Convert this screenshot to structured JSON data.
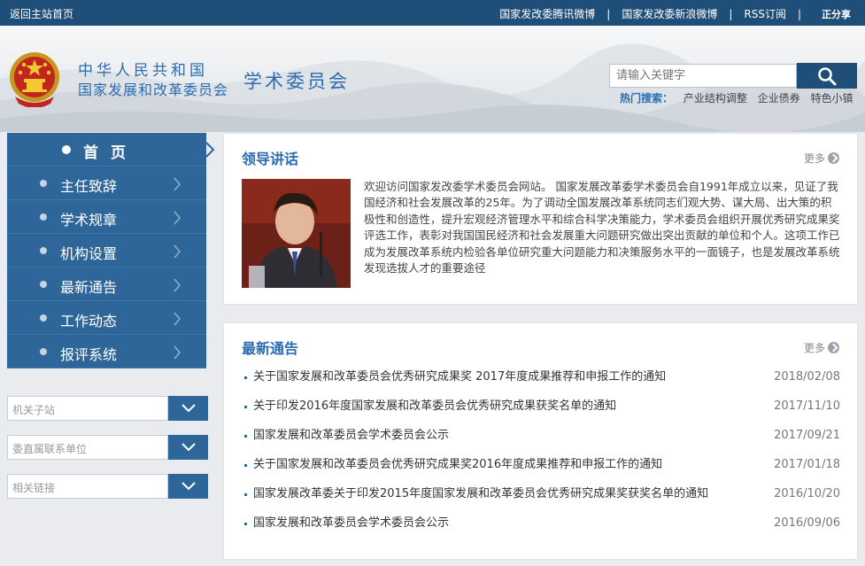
{
  "topbar": {
    "home_link": "返回主站首页",
    "links": [
      "国家发改委腾讯微博",
      "国家发改委新浪微博",
      "RSS订阅"
    ],
    "pc_version": "正分享"
  },
  "header": {
    "org_line1": "中华人民共和国",
    "org_line2": "国家发展和改革委员会",
    "subtitle": "学术委员会",
    "search_placeholder": "请输入关键字",
    "hot_label": "热门搜索：",
    "hot_items": [
      "产业结构调整",
      "企业债券",
      "特色小镇"
    ]
  },
  "nav": {
    "items": [
      {
        "label": "首页"
      },
      {
        "label": "主任致辞"
      },
      {
        "label": "学术规章"
      },
      {
        "label": "机构设置"
      },
      {
        "label": "最新通告"
      },
      {
        "label": "工作动态"
      },
      {
        "label": "报评系统"
      }
    ]
  },
  "dropdowns": [
    {
      "label": "机关子站"
    },
    {
      "label": "委直属联系单位"
    },
    {
      "label": "相关链接"
    }
  ],
  "speech": {
    "title": "领导讲话",
    "more": "更多",
    "text": "欢迎访问国家发改委学术委员会网站。 国家发展改革委学术委员会自1991年成立以来，见证了我国经济和社会发展改革的25年。为了调动全国发展改革系统同志们观大势、谋大局、出大策的积极性和创造性，提升宏观经济管理水平和综合科学决策能力，学术委员会组织开展优秀研究成果奖评选工作，表彰对我国国民经济和社会发展重大问题研究做出突出贡献的单位和个人。这项工作已成为发展改革系统内检验各单位研究重大问题能力和决策服务水平的一面镜子，也是发展改革系统发现选拔人才的重要途径"
  },
  "notices": {
    "title": "最新通告",
    "more": "更多",
    "items": [
      {
        "title": "关于国家发展和改革委员会优秀研究成果奖 2017年度成果推荐和申报工作的通知",
        "date": "2018/02/08"
      },
      {
        "title": "关于印发2016年度国家发展和改革委员会优秀研究成果获奖名单的通知",
        "date": "2017/11/10"
      },
      {
        "title": "国家发展和改革委员会学术委员会公示",
        "date": "2017/09/21"
      },
      {
        "title": "关于国家发展和改革委员会优秀研究成果奖2016年度成果推荐和申报工作的通知",
        "date": "2017/01/18"
      },
      {
        "title": "国家发展改革委关于印发2015年度国家发展和改革委员会优秀研究成果奖获奖名单的通知",
        "date": "2016/10/20"
      },
      {
        "title": "国家发展和改革委员会学术委员会公示",
        "date": "2016/09/06"
      }
    ]
  },
  "colors": {
    "primary": "#1f4e79",
    "nav": "#2f6699",
    "accent_text": "#2b6cb0"
  }
}
